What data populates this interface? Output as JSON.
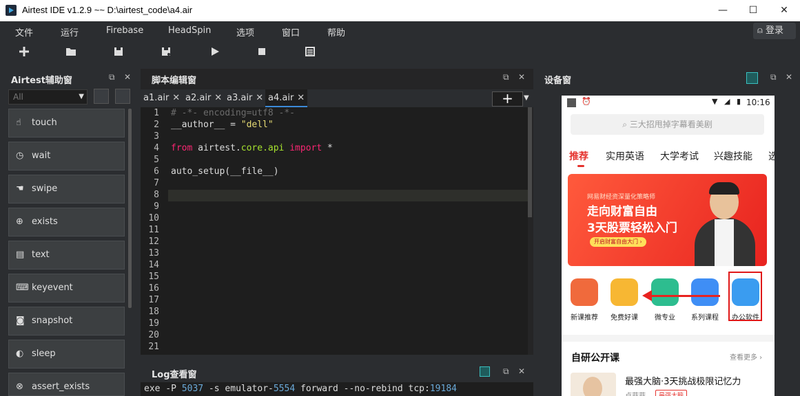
{
  "window": {
    "title": "Airtest IDE v1.2.9 ~~ D:\\airtest_code\\a4.air",
    "minimize": "—",
    "maximize": "☐",
    "close": "✕"
  },
  "menu": [
    "文件",
    "运行",
    "Firebase",
    "HeadSpin",
    "选项",
    "窗口",
    "帮助"
  ],
  "login": "登录",
  "toolbar": [
    "new-icon",
    "open-icon",
    "save-icon",
    "save-as-icon",
    "run-icon",
    "stop-icon",
    "log-icon"
  ],
  "assist": {
    "title": "Airtest辅助窗",
    "filter": "All",
    "buttons": [
      "touch",
      "wait",
      "swipe",
      "exists",
      "text",
      "keyevent",
      "snapshot",
      "sleep",
      "assert_exists"
    ]
  },
  "editor": {
    "title": "脚本编辑窗",
    "tabs": [
      "a1.air",
      "a2.air",
      "a3.air",
      "a4.air"
    ],
    "active_tab": "a4.air",
    "line_numbers": [
      "1",
      "2",
      "3",
      "4",
      "5",
      "6",
      "7",
      "8",
      "9",
      "10",
      "11",
      "12",
      "13",
      "14",
      "15",
      "16",
      "17",
      "18",
      "19",
      "20",
      "21"
    ],
    "code": {
      "l1": "# -*- encoding=utf8 -*-",
      "l2a": "__author__ = ",
      "l2b": "\"dell\"",
      "l4a": "from",
      "l4b": " airtest.",
      "l4c": "core.api",
      "l4d": " ",
      "l4e": "import",
      "l4f": " *",
      "l6": "auto_setup(__file__)"
    }
  },
  "log": {
    "title": "Log查看窗",
    "line": {
      "a": "exe -P ",
      "b": "5037",
      "c": " -s emulator-",
      "d": "5554",
      "e": " forward --no-rebind tcp:",
      "f": "19184"
    }
  },
  "device": {
    "title": "设备窗",
    "status_time": "10:16",
    "search": "三大招甩掉字幕看美剧",
    "categories": [
      "推荐",
      "实用英语",
      "大学考试",
      "兴趣技能",
      "选"
    ],
    "banner": {
      "small": "网易财经资深量化策略师",
      "line1": "走向财富自由",
      "line2": "3天股票轻松入门",
      "button": "开启财富自由大门 ›"
    },
    "icons": [
      {
        "label": "新课推荐",
        "color": "#f06a3c"
      },
      {
        "label": "免费好课",
        "color": "#f7b733"
      },
      {
        "label": "微专业",
        "color": "#2dbd8f"
      },
      {
        "label": "系列课程",
        "color": "#3f8ef5"
      },
      {
        "label": "办公软件",
        "color": "#3a9cf0"
      }
    ],
    "section_title": "自研公开课",
    "section_more": "查看更多 ›",
    "course_title": "最强大脑·3天挑战极限记忆力",
    "course_author": "卢菲菲",
    "course_tag": "最强大脑"
  }
}
